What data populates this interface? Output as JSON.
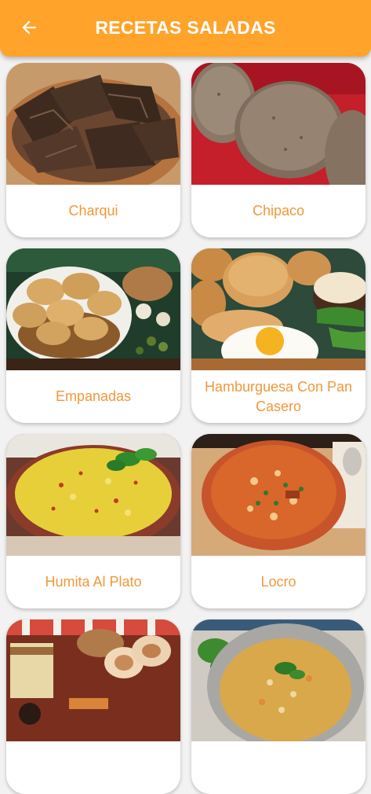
{
  "appbar": {
    "title": "RECETAS SALADAS",
    "back_icon": "arrow-left-icon",
    "color": "#ffa32b"
  },
  "recipes": [
    {
      "label": "Charqui",
      "image": "charqui-photo"
    },
    {
      "label": "Chipaco",
      "image": "chipaco-photo"
    },
    {
      "label": "Empanadas",
      "image": "empanadas-photo"
    },
    {
      "label": "Hamburguesa Con Pan Casero",
      "image": "hamburguesa-photo"
    },
    {
      "label": "Humita Al Plato",
      "image": "humita-photo"
    },
    {
      "label": "Locro",
      "image": "locro-photo"
    },
    {
      "label": "",
      "image": "platter-photo"
    },
    {
      "label": "",
      "image": "soup-bowl-photo"
    }
  ],
  "colors": {
    "accent": "#ffa32b",
    "label_text": "#f0983a",
    "background": "#f2f2f2",
    "card": "#ffffff"
  }
}
